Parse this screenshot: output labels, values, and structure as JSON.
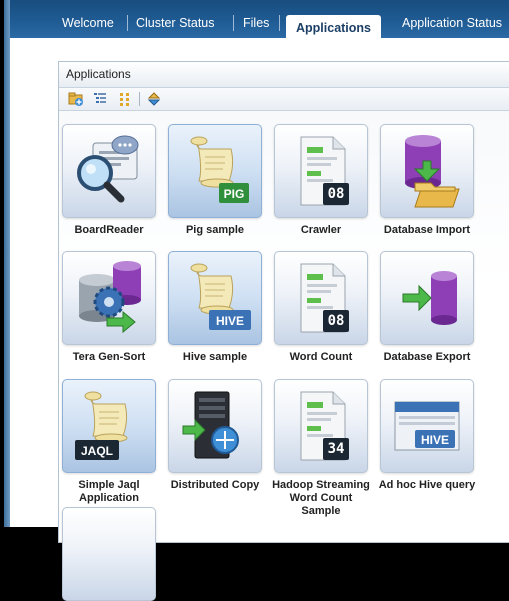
{
  "tabs": [
    {
      "label": "Welcome",
      "active": false
    },
    {
      "label": "Cluster Status",
      "active": false
    },
    {
      "label": "Files",
      "active": false
    },
    {
      "label": "Applications",
      "active": true
    },
    {
      "label": "Application Status",
      "active": false
    }
  ],
  "panel": {
    "title": "Applications",
    "toolbar_icons": [
      "add-folder-icon",
      "list-view-icon",
      "grid-view-icon",
      "refresh-icon"
    ]
  },
  "apps": [
    {
      "label": "BoardReader",
      "icon": "magnifier-document-icon"
    },
    {
      "label": "Pig sample",
      "icon": "scroll-icon",
      "badge": "PIG"
    },
    {
      "label": "Crawler",
      "icon": "document-calendar-icon",
      "badge": "08"
    },
    {
      "label": "Database Import",
      "icon": "database-import-icon"
    },
    {
      "label": "Tera Gen-Sort",
      "icon": "database-gear-icon"
    },
    {
      "label": "Hive sample",
      "icon": "scroll-icon",
      "badge": "HIVE"
    },
    {
      "label": "Word Count",
      "icon": "document-calendar-icon",
      "badge": "08"
    },
    {
      "label": "Database Export",
      "icon": "database-export-icon"
    },
    {
      "label": "Simple Jaql Application",
      "icon": "scroll-icon",
      "badge": "JAQL"
    },
    {
      "label": "Distributed Copy",
      "icon": "server-icon"
    },
    {
      "label": "Hadoop Streaming Word Count Sample",
      "icon": "document-calendar-icon",
      "badge": "34"
    },
    {
      "label": "Ad hoc Hive query",
      "icon": "hive-window-icon",
      "badge": "HIVE"
    }
  ],
  "colors": {
    "tabbar": "#1f5b93",
    "tile_border": "#b7c5d5",
    "badge_dark": "#1b2733",
    "badge_blue": "#3b72b5",
    "badge_green": "#2f8f3a"
  }
}
